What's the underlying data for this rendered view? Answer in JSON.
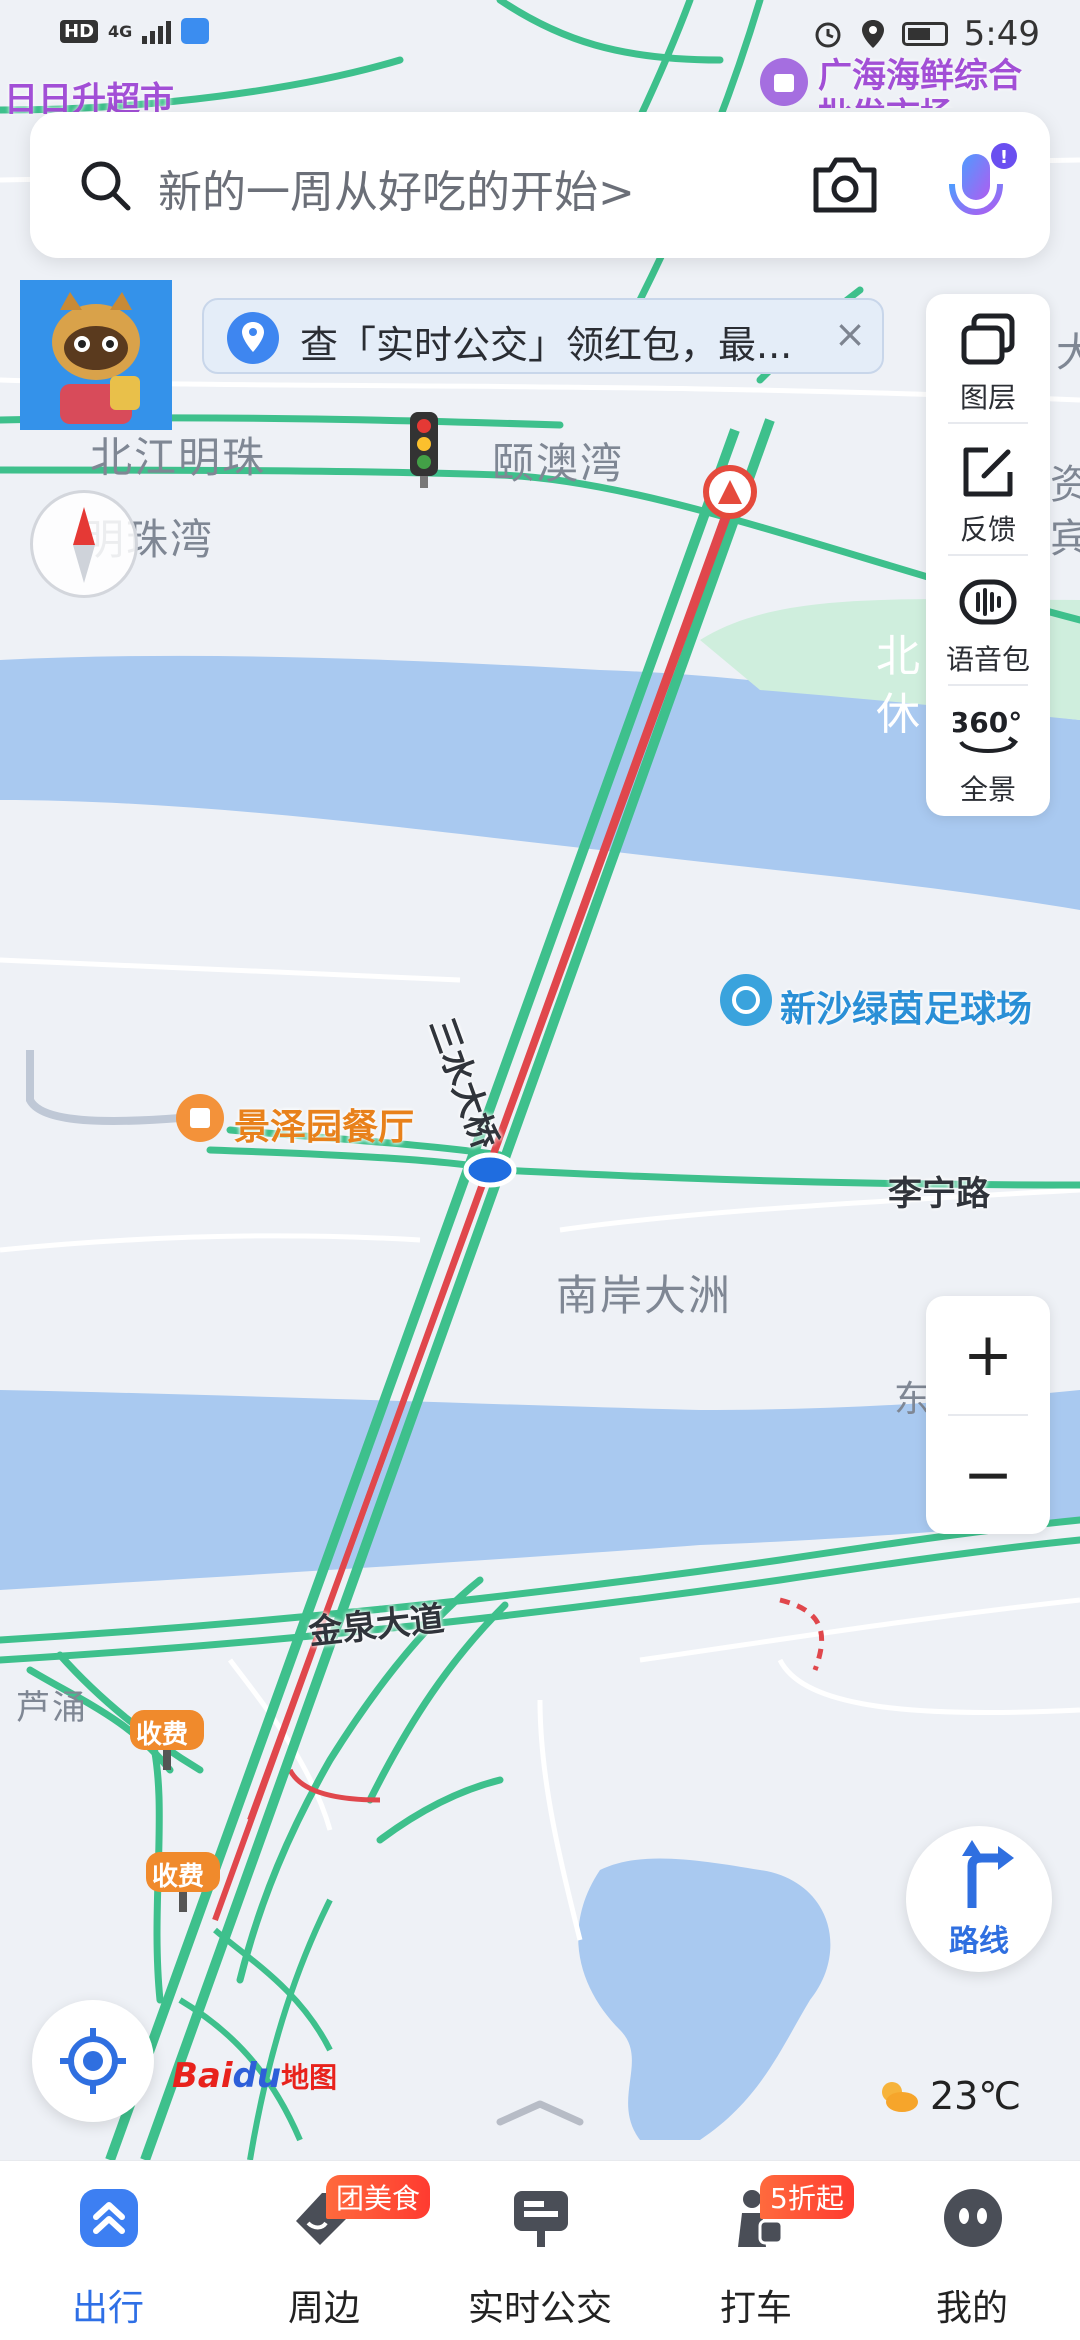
{
  "status_bar": {
    "hd": "HD",
    "network": "4G",
    "time": "5:49"
  },
  "search": {
    "placeholder": "新的一周从好吃的开始>"
  },
  "banner": {
    "text": "查「实时公交」领红包，最...",
    "close": "×"
  },
  "tools": [
    {
      "label": "图层",
      "icon": "layers-icon"
    },
    {
      "label": "反馈",
      "icon": "feedback-icon"
    },
    {
      "label": "语音包",
      "icon": "voice-pack-icon"
    },
    {
      "label": "全景",
      "icon": "panorama-360-icon"
    }
  ],
  "panorama_glyph": "360°",
  "zoom": {
    "in": "+",
    "out": "−"
  },
  "route_button": {
    "label": "路线"
  },
  "logo": {
    "part1": "Bai",
    "part2": "du",
    "part3": "地图"
  },
  "weather": {
    "temperature": "23℃",
    "icon": "partly-cloudy-icon"
  },
  "map": {
    "area_labels": [
      {
        "text": "北江明珠"
      },
      {
        "text": "明珠湾"
      },
      {
        "text": "颐澳湾"
      },
      {
        "text": "南岸大洲"
      },
      {
        "text": "芦涌"
      }
    ],
    "road_labels": [
      {
        "text": "李宁路"
      },
      {
        "text": "金泉大道"
      },
      {
        "text": "三水大桥"
      }
    ],
    "pois": [
      {
        "text": "日日升超市"
      },
      {
        "text": "广海海鲜综合"
      },
      {
        "text": "批发市场"
      },
      {
        "text": "景泽园餐厅"
      },
      {
        "text": "新沙绿茵足球场"
      }
    ],
    "edge_fragments": [
      "大",
      "资",
      "宾",
      "北",
      "休",
      "东"
    ],
    "toll_labels": [
      "收费",
      "收费"
    ]
  },
  "bottom_nav": [
    {
      "label": "出行",
      "active": true,
      "badge": ""
    },
    {
      "label": "周边",
      "active": false,
      "badge": "团美食"
    },
    {
      "label": "实时公交",
      "active": false,
      "badge": ""
    },
    {
      "label": "打车",
      "active": false,
      "badge": "5折起"
    },
    {
      "label": "我的",
      "active": false,
      "badge": ""
    }
  ],
  "colors": {
    "road_green": "#3ec08c",
    "road_red": "#e0474c",
    "water": "#a9c9f0",
    "land": "#eef1f6",
    "accent": "#2e6fe6"
  }
}
